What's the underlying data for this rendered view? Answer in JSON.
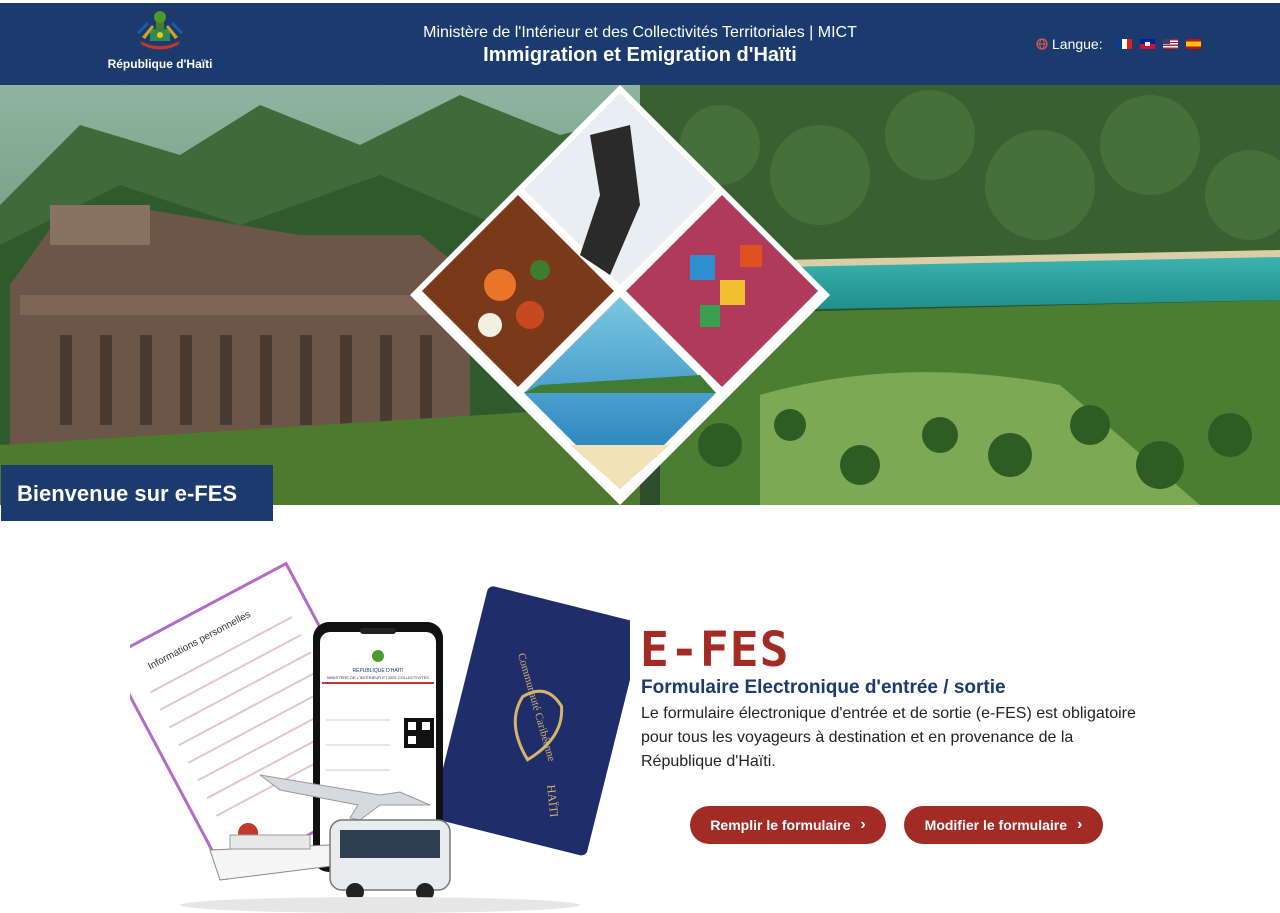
{
  "header": {
    "republic_label": "République d'Haïti",
    "ministry_line": "Ministère de l'Intérieur et des Collectivités Territoriales | MICT",
    "site_title": "Immigration et Emigration d'Haïti",
    "language_label": "Langue:",
    "globe_icon": "globe-icon",
    "flags": [
      "flag-fr-icon",
      "flag-ht-icon",
      "flag-us-icon",
      "flag-es-icon"
    ]
  },
  "hero": {
    "welcome": "Bienvenue sur e-FES"
  },
  "main": {
    "title": "E-FES",
    "subtitle": "Formulaire Electronique d'entrée / sortie",
    "description": "Le formulaire électronique d'entrée et de sortie (e-FES) est obligatoire pour tous les voyageurs à destination et en provenance de la République d'Haïti.",
    "fill_button": "Remplir le formulaire",
    "edit_button": "Modifier le formulaire"
  },
  "illustration": {
    "phone_header_1": "RÉPUBLIQUE D'HAÏTI",
    "phone_header_2": "MINISTÈRE DE L'INTÉRIEUR ET DES COLLECTIVITÉS",
    "form_heading": "Informations personnelles",
    "passport_text_1": "Communauté Caribéenne",
    "passport_text_2": "HAÏTI"
  },
  "colors": {
    "header_bg": "#1b3a6e",
    "accent_red": "#a32b25",
    "title_blue": "#1b3a6e"
  }
}
